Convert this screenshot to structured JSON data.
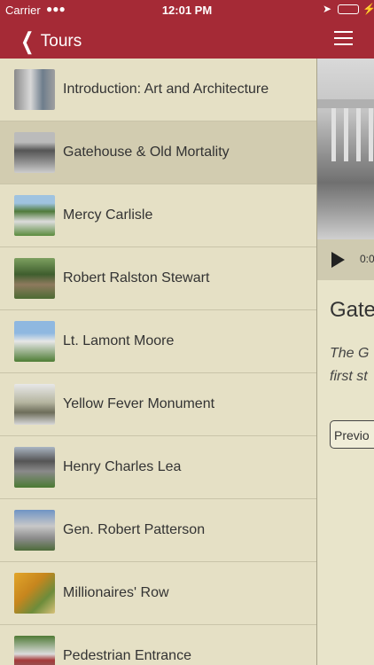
{
  "status_bar": {
    "carrier": "Carrier",
    "time": "12:01 PM"
  },
  "nav": {
    "back_label": "Tours"
  },
  "tour_items": [
    {
      "label": "Introduction: Art and Architecture"
    },
    {
      "label": "Gatehouse & Old Mortality"
    },
    {
      "label": "Mercy Carlisle"
    },
    {
      "label": "Robert Ralston Stewart"
    },
    {
      "label": "Lt. Lamont Moore"
    },
    {
      "label": "Yellow Fever Monument"
    },
    {
      "label": "Henry Charles Lea"
    },
    {
      "label": "Gen. Robert Patterson"
    },
    {
      "label": "Millionaires' Row"
    },
    {
      "label": "Pedestrian Entrance"
    }
  ],
  "detail": {
    "audio_time": "0:0",
    "title": "Gate",
    "desc_line1": "The G",
    "desc_line2": "first st",
    "previous_label": "Previo"
  }
}
